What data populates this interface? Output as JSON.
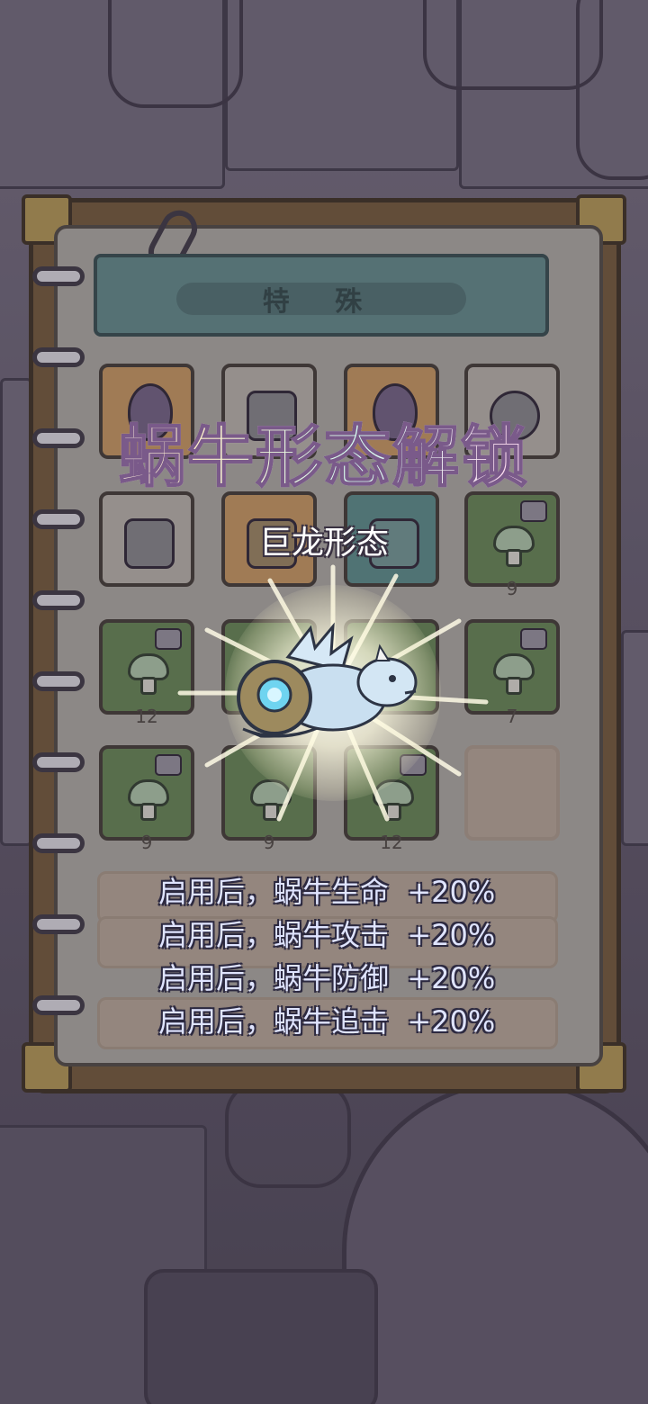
{
  "tab": {
    "label": "特 殊"
  },
  "unlock": {
    "title": "蜗牛形态解锁",
    "form_name": "巨龙形态"
  },
  "bonuses": [
    {
      "label": "启用后，蜗牛生命",
      "value": "+20%"
    },
    {
      "label": "启用后，蜗牛攻击",
      "value": "+20%"
    },
    {
      "label": "启用后，蜗牛防御",
      "value": "+20%"
    },
    {
      "label": "启用后，蜗牛追击",
      "value": "+20%"
    }
  ],
  "grid_counts": {
    "r2c4": "9",
    "r3c1": "12",
    "r3c4": "7",
    "r4c1": "9",
    "r4c2": "9",
    "r4c3": "12"
  },
  "icons": {
    "slots": [
      "egg-icon",
      "scroll-bag-icon",
      "egg-icon",
      "mask-icon",
      "backpack-icon",
      "flower-bag-icon",
      "book-icon",
      "mushroom-icon",
      "mushroom-icon",
      "mushroom-icon",
      "mushroom-icon",
      "mushroom-icon",
      "mushroom-icon",
      "mushroom-icon"
    ]
  },
  "colors": {
    "accent_title_outline": "#7a5a8a",
    "bonus_text": "#dfe4ff",
    "header_banner": "#5b7e7e"
  }
}
